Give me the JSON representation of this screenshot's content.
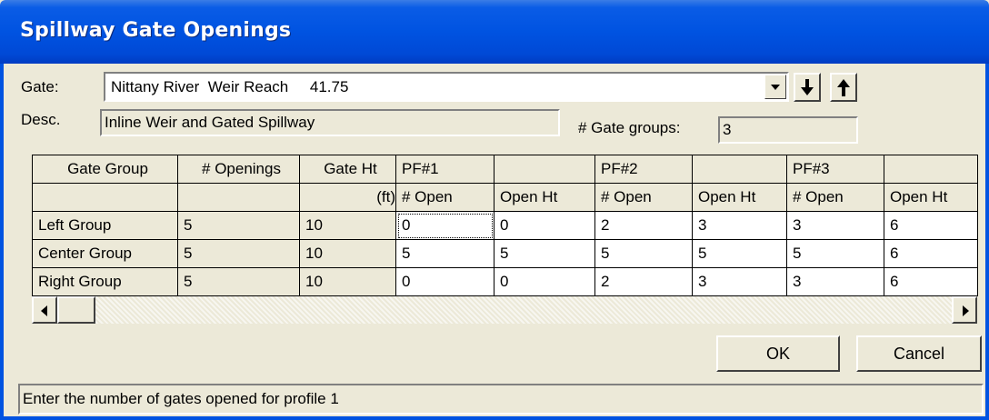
{
  "window": {
    "title": "Spillway Gate Openings"
  },
  "gate": {
    "label": "Gate:",
    "selected": "Nittany River  Weir Reach     41.75",
    "desc_label": "Desc.",
    "desc_value": "Inline Weir and Gated Spillway",
    "groups_label": "# Gate groups:",
    "groups_value": "3"
  },
  "table": {
    "header_row1": [
      "Gate Group",
      "# Openings",
      "Gate Ht",
      "PF#1",
      "",
      "PF#2",
      "",
      "PF#3",
      ""
    ],
    "header_row2": [
      "",
      "",
      "(ft)",
      "# Open",
      "Open Ht",
      "# Open",
      "Open Ht",
      "# Open",
      "Open Ht"
    ],
    "rows": [
      {
        "group": "Left Group",
        "openings": "5",
        "gate_ht": "10",
        "values": [
          "0",
          "0",
          "2",
          "3",
          "3",
          "6"
        ]
      },
      {
        "group": "Center Group",
        "openings": "5",
        "gate_ht": "10",
        "values": [
          "5",
          "5",
          "5",
          "5",
          "5",
          "6"
        ]
      },
      {
        "group": "Right Group",
        "openings": "5",
        "gate_ht": "10",
        "values": [
          "0",
          "0",
          "2",
          "3",
          "3",
          "6"
        ]
      }
    ]
  },
  "buttons": {
    "ok": "OK",
    "cancel": "Cancel"
  },
  "status": "Enter the number of gates opened for profile 1"
}
